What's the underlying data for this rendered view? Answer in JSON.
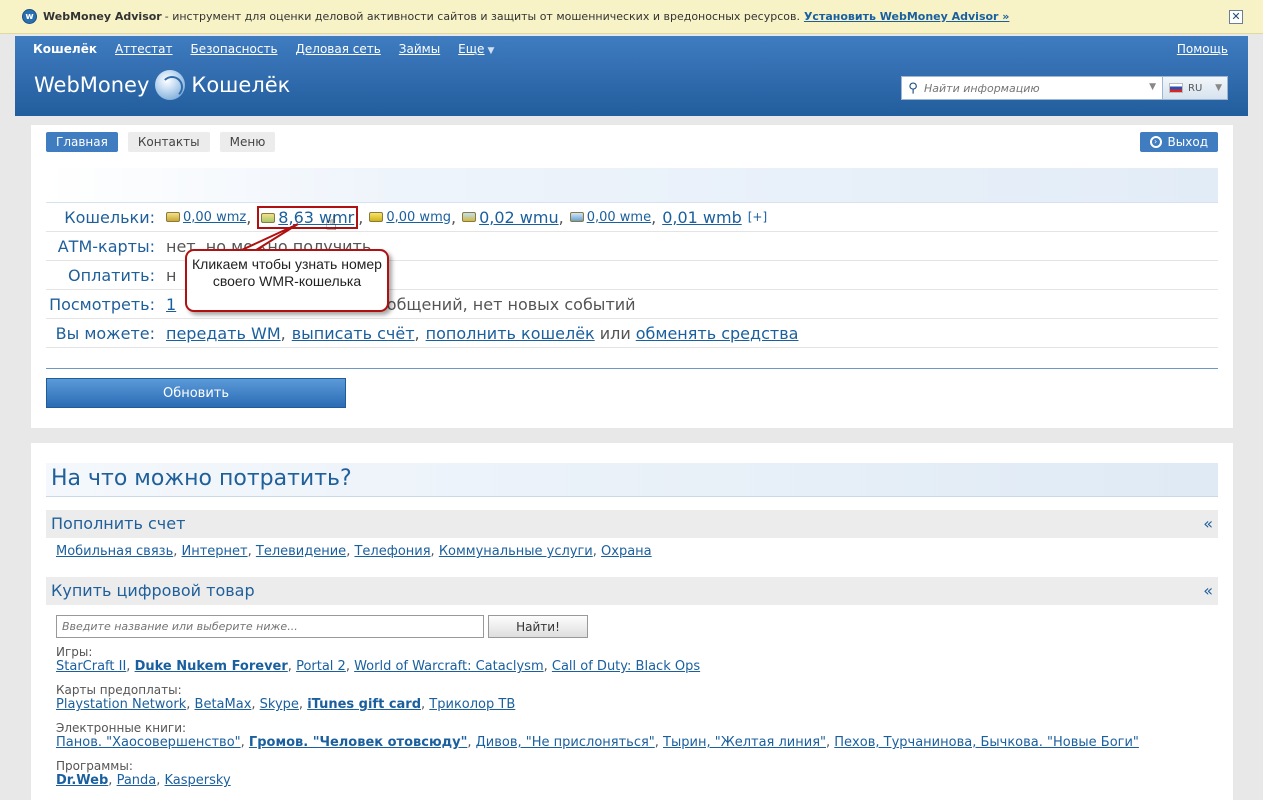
{
  "advisor": {
    "brand": "WebMoney Advisor",
    "text": "- инструмент для оценки деловой активности сайтов и защиты от мошеннических и вредоносных ресурсов.",
    "install": "Установить WebMoney Advisor »",
    "close": "✕"
  },
  "nav": {
    "items": [
      "Кошелёк",
      "Аттестат",
      "Безопасность",
      "Деловая сеть",
      "Займы",
      "Еще"
    ],
    "help": "Помощь"
  },
  "logo": {
    "left": "WebMoney",
    "right": "Кошелёк"
  },
  "search": {
    "placeholder": "Найти информацию"
  },
  "lang": {
    "code": "RU"
  },
  "tabs": {
    "main": "Главная",
    "contacts": "Контакты",
    "menu": "Меню",
    "logout": "Выход"
  },
  "wallets": {
    "label": "Кошельки:",
    "wmz": "0,00 wmz",
    "wmr": "8,63 wmr",
    "wmg": "0,00 wmg",
    "wmu": "0,02 wmu",
    "wme": "0,00 wme",
    "wmb": "0,01 wmb",
    "add": "[+]"
  },
  "atm": {
    "label": "АТМ-карты:",
    "value": "нет, но можно получить"
  },
  "pay": {
    "label": "Оплатить:",
    "value": "н"
  },
  "view": {
    "label": "Посмотреть:",
    "link": "1",
    "value": "сообщений, нет новых событий"
  },
  "can": {
    "label": "Вы можете:",
    "send": "передать WM",
    "invoice": "выписать счёт",
    "topup": "пополнить кошелёк",
    "or": "или",
    "exchange": "обменять средства"
  },
  "refresh": "Обновить",
  "callout": "Кликаем чтобы узнать номер своего WMR-кошелька",
  "spend": {
    "title": "На что можно потратить?",
    "topup_title": "Пополнить счет",
    "chev": "«",
    "topup_links": [
      "Мобильная связь",
      "Интернет",
      "Телевидение",
      "Телефония",
      "Коммунальные услуги",
      "Охрана"
    ],
    "digital_title": "Купить цифровой товар",
    "find_placeholder": "Введите название или выберите ниже...",
    "find_button": "Найти!",
    "games_title": "Игры:",
    "games": [
      "StarCraft II",
      "Duke Nukem Forever",
      "Portal 2",
      "World of Warcraft: Cataclysm",
      "Call of Duty: Black Ops"
    ],
    "cards_title": "Карты предоплаты:",
    "cards": [
      "Playstation Network",
      "BetaMax",
      "Skype",
      "iTunes gift card",
      "Триколор ТВ"
    ],
    "books_title": "Электронные книги:",
    "books": [
      "Панов. \"Хаосовершенство\"",
      "Громов. \"Человек отовсюду\"",
      "Дивов, \"Не прислоняться\"",
      "Тырин, \"Желтая линия\"",
      "Пехов, Турчанинова, Бычкова. \"Новые Боги\""
    ],
    "soft_title": "Программы:",
    "soft": [
      "Dr.Web",
      "Panda",
      "Kaspersky"
    ]
  }
}
